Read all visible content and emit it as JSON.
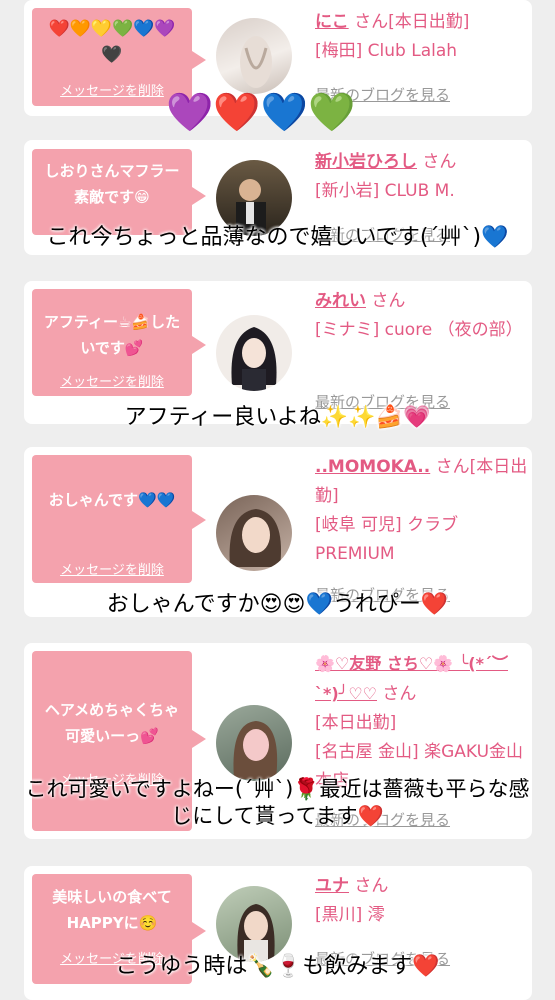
{
  "cards": [
    {
      "message": "❤️🧡💛💚💙💜🖤",
      "delete_label": "メッセージを削除",
      "name": "にこ",
      "suffix": "さん[本日出勤]",
      "location": "[梅田] Club Lalah",
      "blog_label": "最新のブログを見る"
    },
    {
      "message": "しおりさんマフラー素敵です😁",
      "name": "新小岩ひろし",
      "suffix": "さん",
      "location": "[新小岩] CLUB M.",
      "blog_label": "最新のブログを見る"
    },
    {
      "message": "アフティー☕🍰したいです💕",
      "delete_label": "メッセージを削除",
      "name": "みれい",
      "suffix": "さん",
      "location": "[ミナミ] cuore （夜の部）",
      "blog_label": "最新のブログを見る"
    },
    {
      "message": "おしゃんです💙💙",
      "delete_label": "メッセージを削除",
      "name": "..MOMOKA..",
      "suffix": "さん[本日出勤]",
      "location": "[岐阜 可児] クラブPREMIUM",
      "blog_label": "最新のブログを見る"
    },
    {
      "message": "ヘアメめちゃくちゃ可愛いーっ💕",
      "delete_label": "メッセージを削除",
      "name": "🌸♡友野 さち♡🌸 ╰(*´︶`*)╯♡♡",
      "suffix": "さん",
      "status": "[本日出勤]",
      "location": "[名古屋 金山] 楽GAKU金山本店",
      "blog_label": "最新のブログを見る"
    },
    {
      "message": "美味しいの食べてHAPPYに☺️",
      "delete_label": "メッセージを削除",
      "name": "ユナ",
      "suffix": "さん",
      "location": "[黒川] 澪",
      "blog_label": "最新のブログを見る"
    }
  ],
  "overlays": {
    "hearts": "💜❤️💙💚",
    "caption2": "これ今ちょっと品薄なので嬉しいです(´艸`)💙",
    "caption3": "アフティー良いよね✨✨🍰💗",
    "caption4": "おしゃんですか😍😍💙うれぴー❤️",
    "caption5": "これ可愛いですよねー(´艸`)🌹最近は薔薇も平らな感じにして貰ってます❤️",
    "caption6": "こうゆう時は🍾🍷も飲みます❤️"
  },
  "colors": {
    "accent_pink": "#e35a83",
    "bubble_pink": "#f4a2ad",
    "background": "#eeeeee"
  }
}
